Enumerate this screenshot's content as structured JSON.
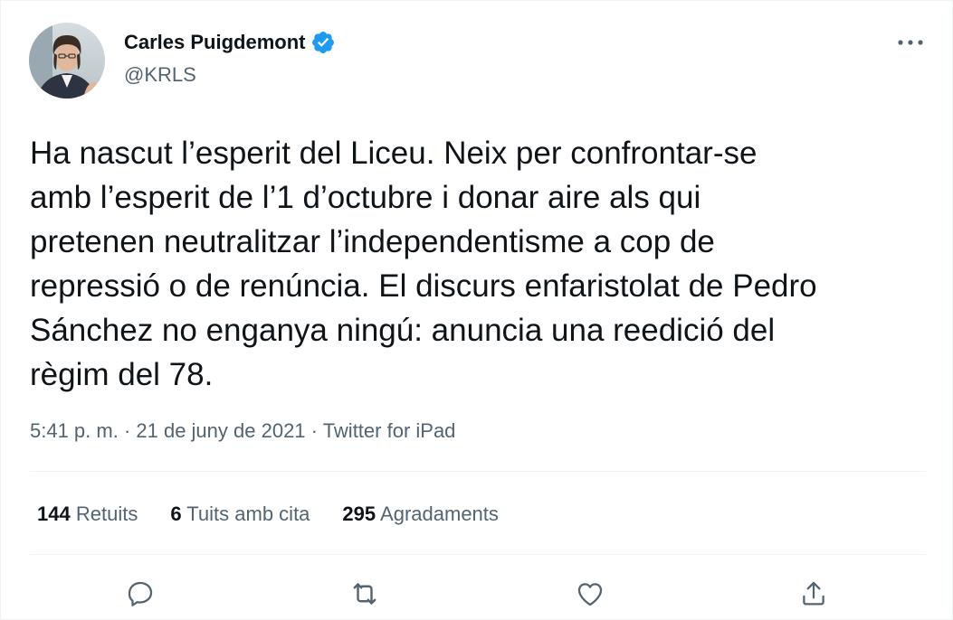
{
  "author": {
    "name": "Carles Puigdemont",
    "handle": "@KRLS",
    "verified": true
  },
  "tweet": {
    "text": "Ha nascut l’esperit del Liceu. Neix per confrontar-se\namb l’esperit de l’1 d’octubre i donar aire als qui\npretenen neutralitzar l’independentisme a cop de\nrepressió o de renúncia. El discurs enfaristolat de Pedro\nSánchez no enganya ningú: anuncia una reedició del\nrègim del 78.",
    "timestamp": "5:41 p. m. · 21 de juny de 2021 · Twitter for iPad"
  },
  "stats": {
    "retweets_count": "144",
    "retweets_label": "Retuits",
    "quotes_count": "6",
    "quotes_label": "Tuits amb cita",
    "likes_count": "295",
    "likes_label": "Agradaments"
  },
  "icons": {
    "reply": "reply-icon",
    "retweet": "retweet-icon",
    "like": "heart-icon",
    "share": "share-icon",
    "more": "more-icon",
    "verified": "verified-badge-icon"
  },
  "colors": {
    "verified": "#1d9bf0",
    "secondary_text": "#536471",
    "divider": "#eff3f4"
  }
}
